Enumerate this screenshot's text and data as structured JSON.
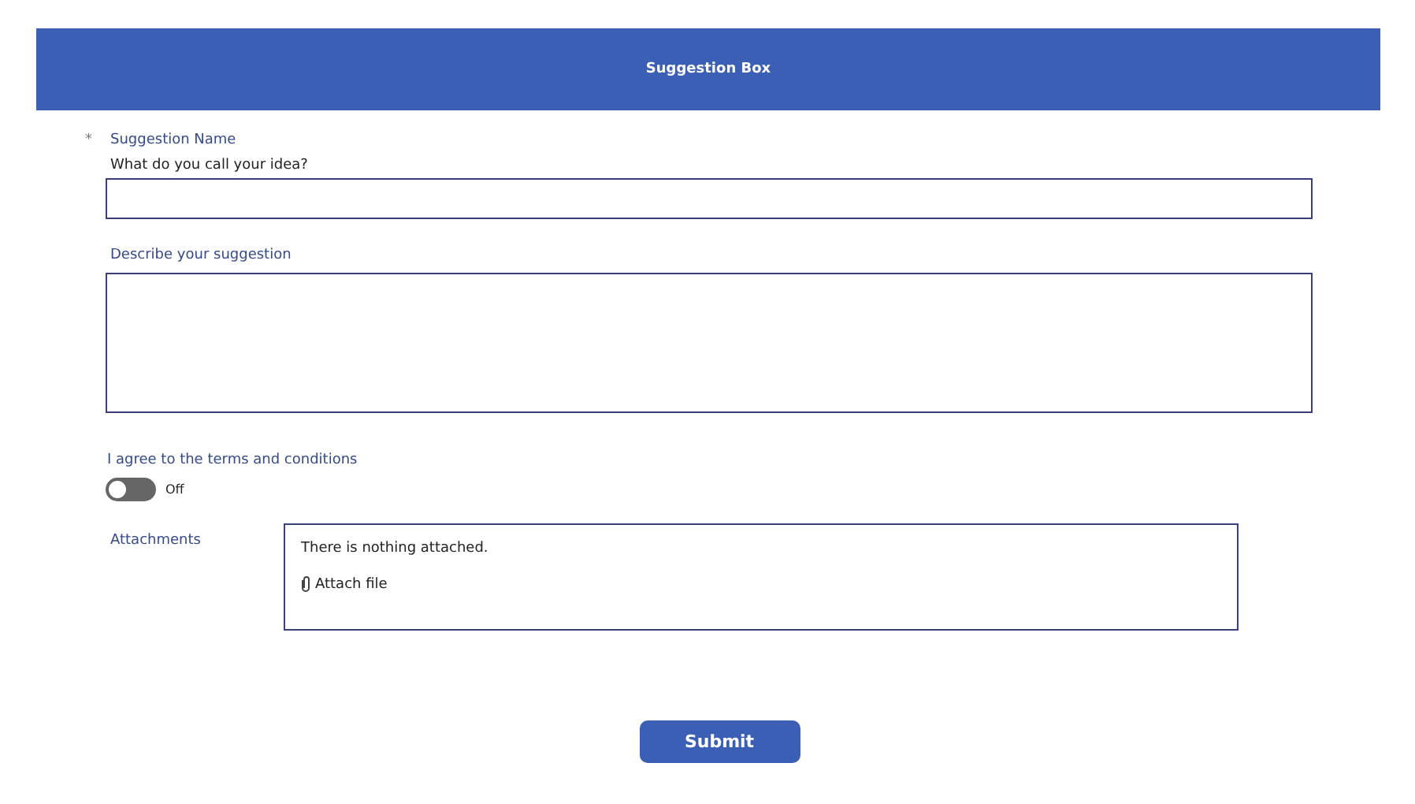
{
  "header": {
    "title": "Suggestion Box"
  },
  "name_field": {
    "label": "Suggestion Name",
    "required": true,
    "required_mark": "*",
    "hint": "What do you call your idea?"
  },
  "description_field": {
    "label": "Describe your suggestion"
  },
  "terms": {
    "label": "I agree to the terms and conditions",
    "on": false,
    "state_text": "Off"
  },
  "attachments": {
    "label": "Attachments",
    "empty_text": "There is nothing attached.",
    "action": "Attach file"
  },
  "submit": {
    "label": "Submit"
  }
}
